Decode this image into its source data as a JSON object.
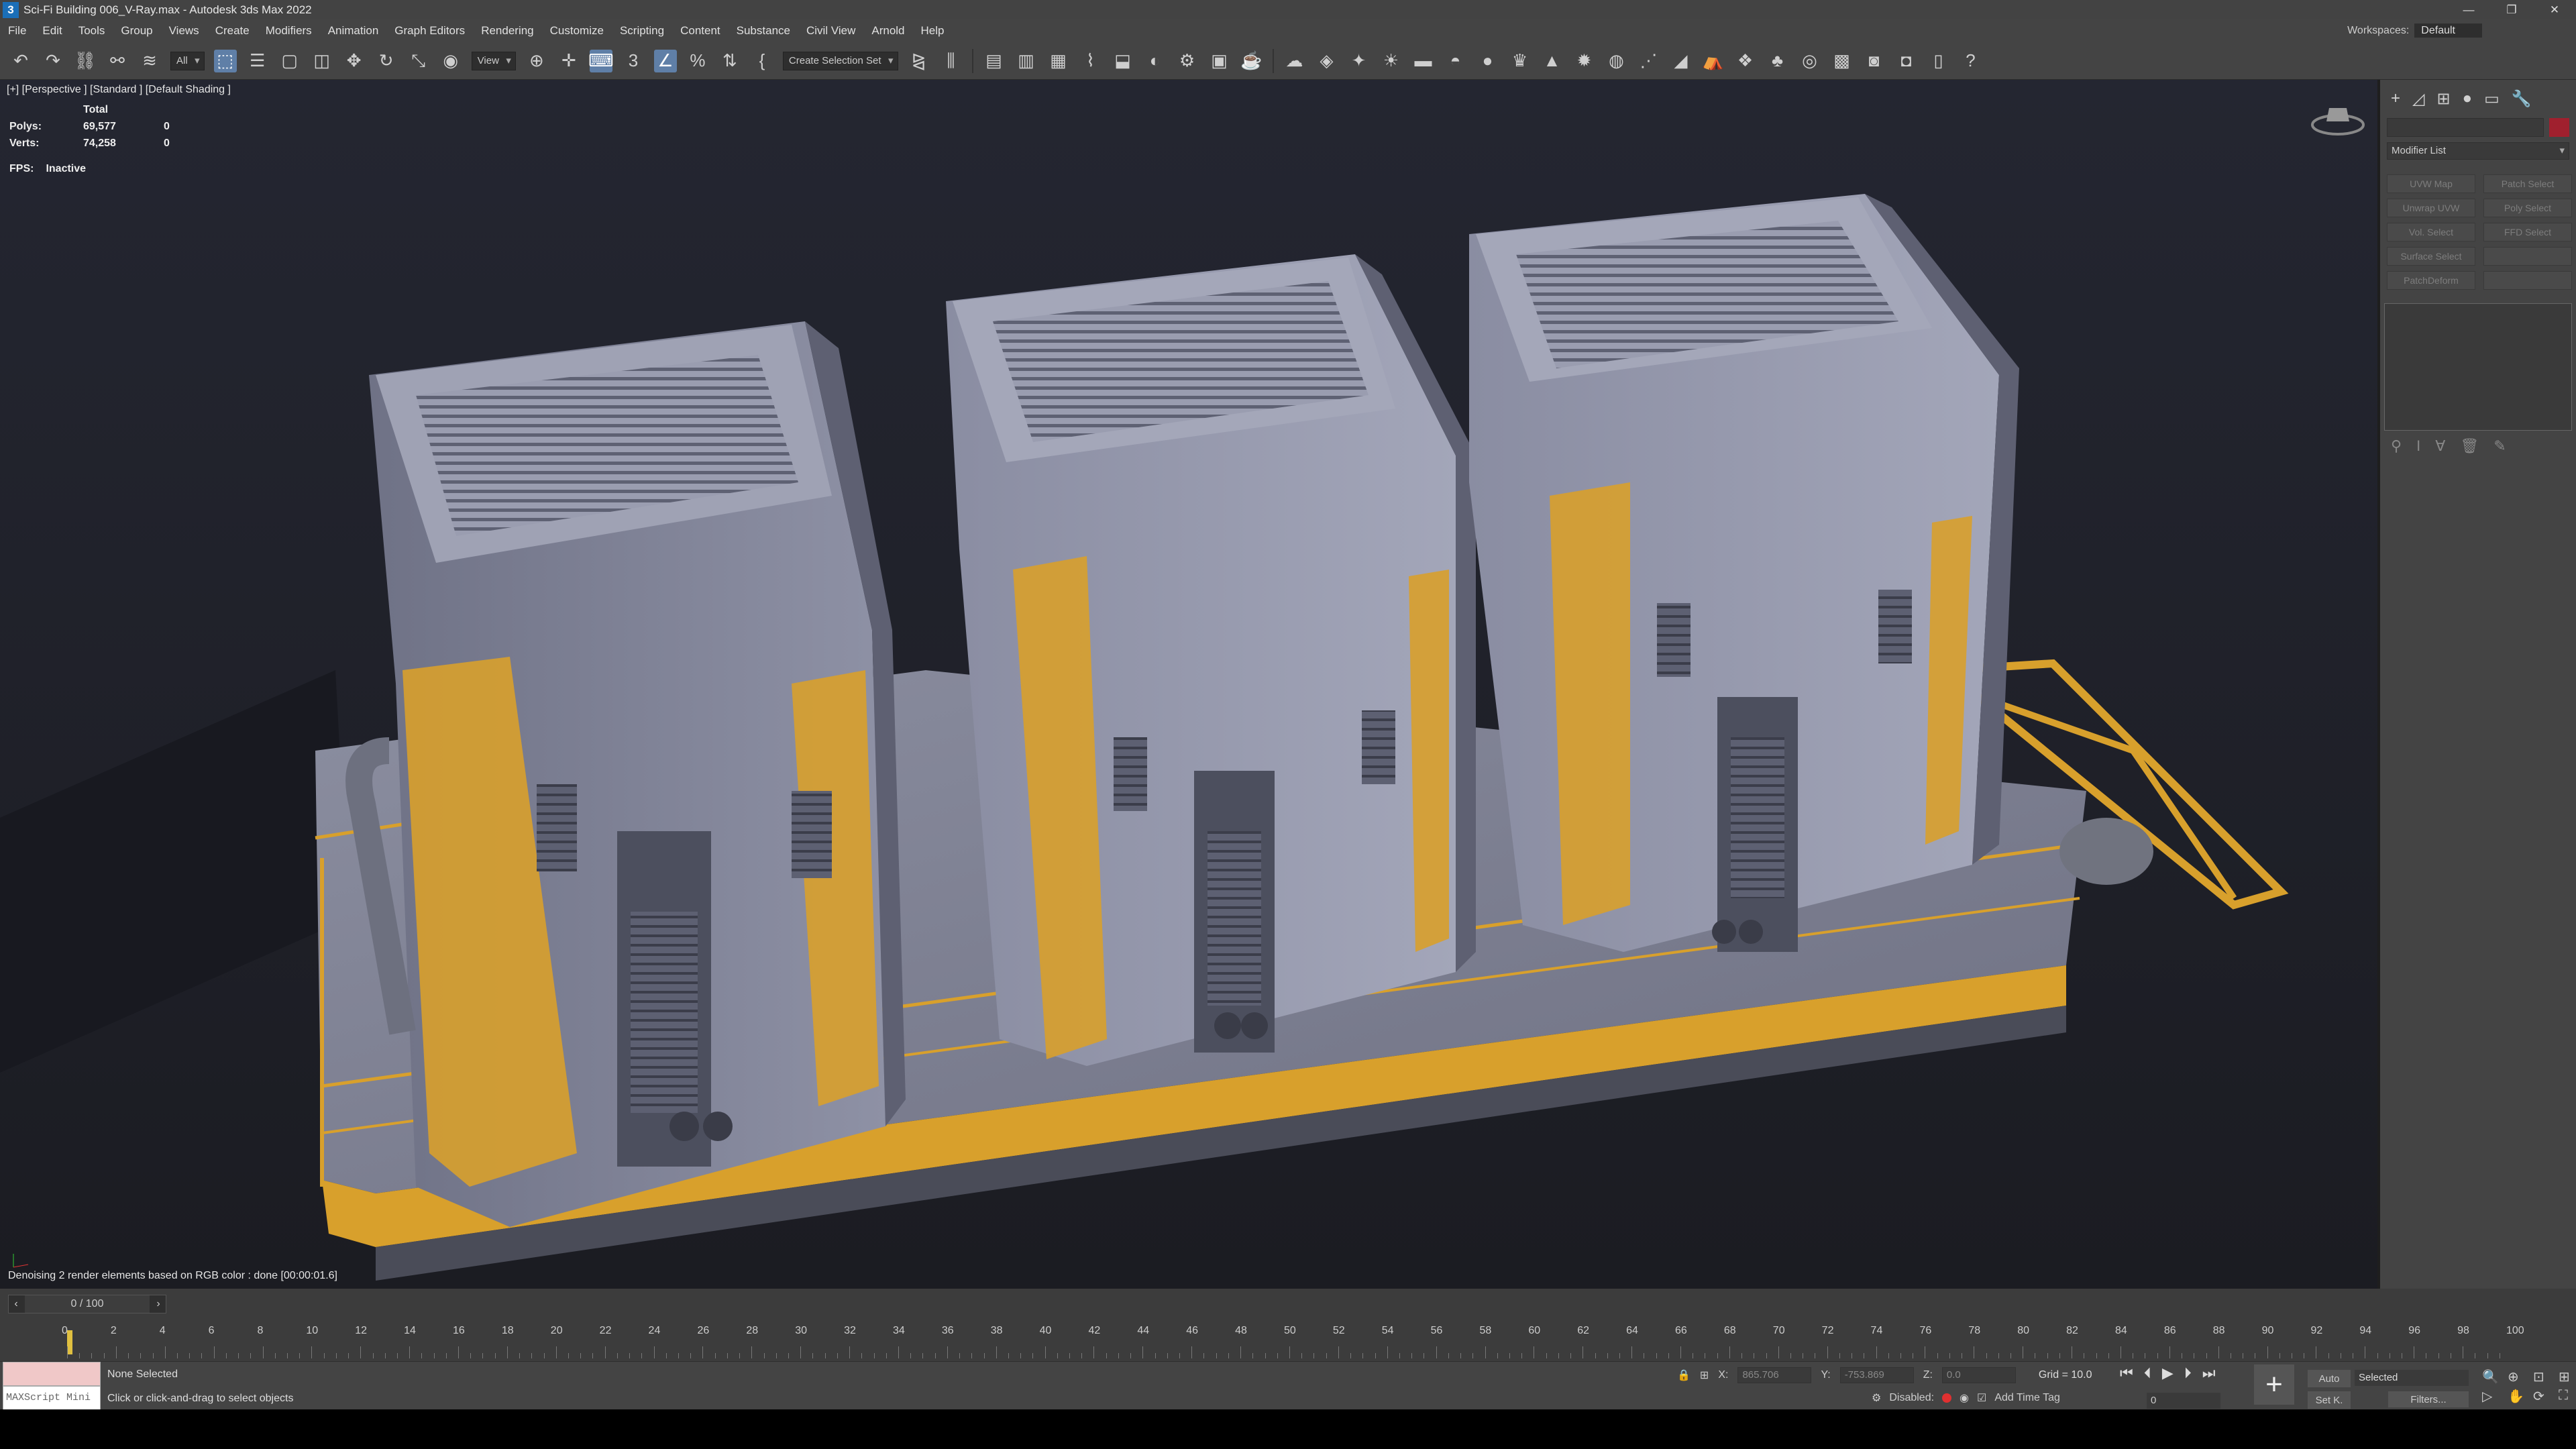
{
  "window": {
    "title": "Sci-Fi Building 006_V-Ray.max - Autodesk 3ds Max 2022",
    "app_icon": "3",
    "controls": [
      "—",
      "❐",
      "✕"
    ]
  },
  "menu": [
    "File",
    "Edit",
    "Tools",
    "Group",
    "Views",
    "Create",
    "Modifiers",
    "Animation",
    "Graph Editors",
    "Rendering",
    "Customize",
    "Scripting",
    "Content",
    "Substance",
    "Civil View",
    "Arnold",
    "Help"
  ],
  "workspace": {
    "label": "Workspaces:",
    "value": "Default"
  },
  "toolbar": {
    "filter": "All",
    "view": "View",
    "selection_set": "Create Selection Set"
  },
  "viewport": {
    "label": "[+] [Perspective ] [Standard ] [Default Shading ]",
    "stats": {
      "header": "Total",
      "polys_label": "Polys:",
      "polys": "69,577",
      "polys_sel": "0",
      "verts_label": "Verts:",
      "verts": "74,258",
      "verts_sel": "0"
    },
    "fps_label": "FPS:",
    "fps": "Inactive",
    "status": "Denoising 2 render elements based on RGB color : done [00:00:01.6]"
  },
  "command_panel": {
    "modifier_list": "Modifier List",
    "modifiers": [
      "UVW Map",
      "Patch Select",
      "Unwrap UVW",
      "Poly Select",
      "Vol. Select",
      "FFD Select",
      "Surface Select",
      "",
      "PatchDeform",
      ""
    ]
  },
  "timeline": {
    "frame": "0 / 100",
    "ticks": [
      "0",
      "2",
      "4",
      "6",
      "8",
      "10",
      "12",
      "14",
      "16",
      "18",
      "20",
      "22",
      "24",
      "26",
      "28",
      "30",
      "32",
      "34",
      "36",
      "38",
      "40",
      "42",
      "44",
      "46",
      "48",
      "50",
      "52",
      "54",
      "56",
      "58",
      "60",
      "62",
      "64",
      "66",
      "68",
      "70",
      "72",
      "74",
      "76",
      "78",
      "80",
      "82",
      "84",
      "86",
      "88",
      "90",
      "92",
      "94",
      "96",
      "98",
      "100"
    ]
  },
  "status": {
    "maxscript": "MAXScript Mini",
    "selection": "None Selected",
    "hint": "Click or click-and-drag to select objects",
    "x_label": "X:",
    "x": "865.706",
    "y_label": "Y:",
    "y": "-753.869",
    "z_label": "Z:",
    "z": "0.0",
    "grid": "Grid = 10.0",
    "disabled": "Disabled:",
    "add_time_tag": "Add Time Tag",
    "auto": "Auto",
    "set_key": "Set K.",
    "selected": "Selected",
    "filters": "Filters...",
    "frame_value": "0"
  },
  "colors": {
    "accent": "#5f7fa7",
    "yellow": "#d8a02c",
    "hull": "#8d90a4",
    "bg": "#1f2127"
  }
}
